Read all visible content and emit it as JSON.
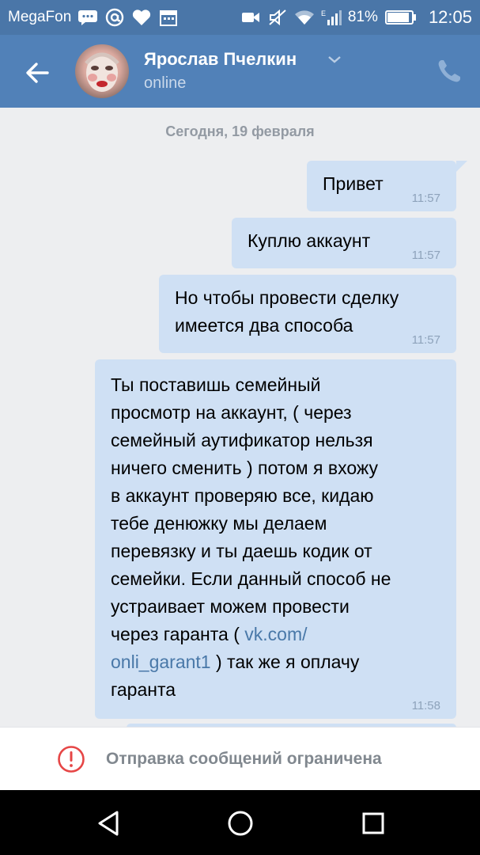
{
  "status_bar": {
    "carrier": "MegaFon",
    "battery": "81%",
    "time": "12:05",
    "network_label": "E",
    "icons": [
      "messages-icon",
      "at-icon",
      "heart-icon",
      "calendar-icon",
      "video-icon",
      "mute-icon",
      "wifi-icon",
      "signal-icon",
      "battery-icon"
    ]
  },
  "header": {
    "name": "Ярослав Пчелкин",
    "status": "online",
    "accent": "#5181b8"
  },
  "chat": {
    "date_label": "Сегодня, 19 февраля",
    "messages": [
      {
        "text": "Привет",
        "time": "11:57"
      },
      {
        "text": "Куплю аккаунт",
        "time": "11:57"
      },
      {
        "text": "Но чтобы провести сделку\nимеется два способа",
        "time": "11:57"
      },
      {
        "text_before": "Ты поставишь семейный\nпросмотр на аккаунт, ( через\nсемейный аутификатор нельзя\nничего сменить ) потом я вхожу\nв аккаунт проверяю все, кидаю\nтебе денюжку мы делаем\nперевязку и ты даешь кодик от\nсемейки. Если данный способ не\nустраивает можем провести\nчерез гаранта ( ",
        "link": "vk.com/\nonli_garant1",
        "text_after": " ) так же я оплачу\nгаранта",
        "time": "11:58"
      }
    ]
  },
  "restricted_bar": {
    "text": "Отправка сообщений ограничена",
    "icon_color": "#e64646"
  },
  "nav": {
    "buttons": [
      "back-triangle-icon",
      "home-circle-icon",
      "recents-square-icon"
    ]
  }
}
